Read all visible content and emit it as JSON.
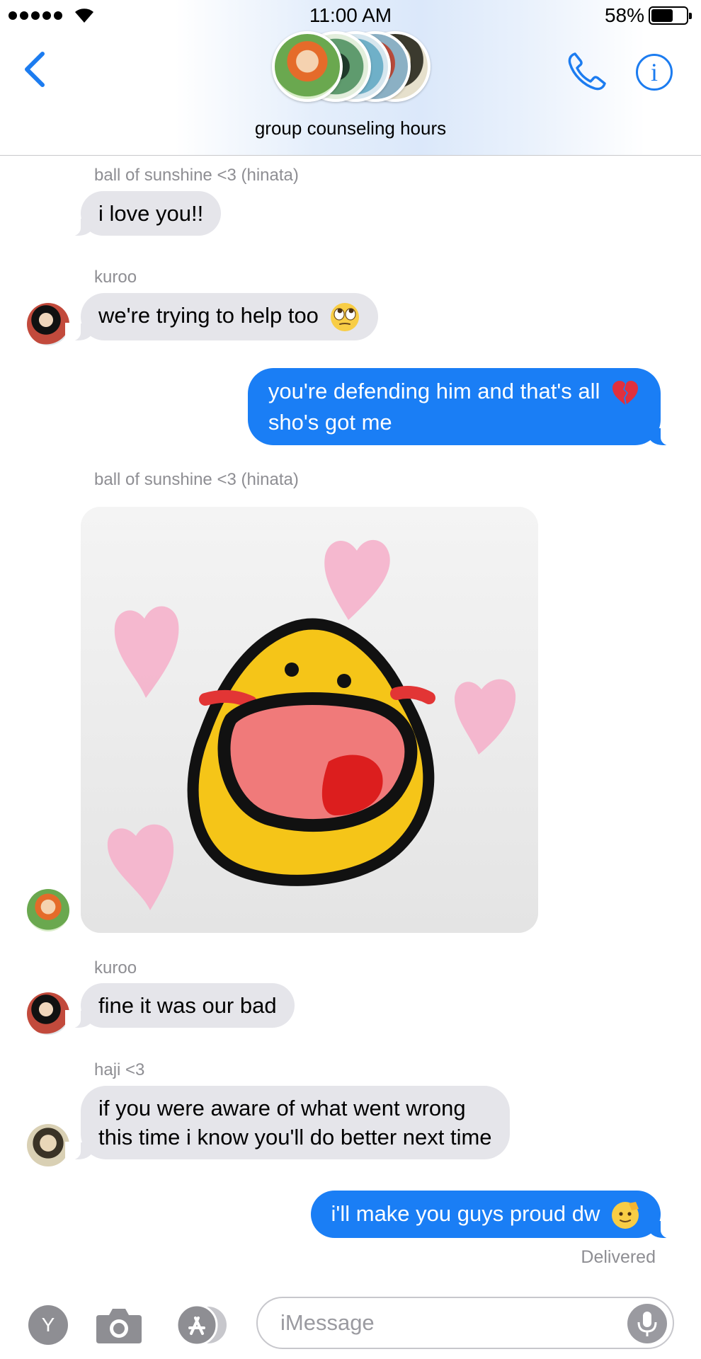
{
  "status_bar": {
    "time": "11:00 AM",
    "battery_percent": "58%",
    "battery_level": 0.58
  },
  "header": {
    "title": "group counseling hours"
  },
  "messages": [
    {
      "sender": "ball of sunshine <3 (hinata)",
      "text": "i love you!!"
    },
    {
      "sender": "kuroo",
      "text": "we're trying to help too",
      "emoji": "face-with-rolling-eyes"
    },
    {
      "outgoing": true,
      "line1": "you're defending him and that's all",
      "line2": "sho's got me",
      "emoji": "broken-heart"
    },
    {
      "sender": "ball of sunshine <3 (hinata)",
      "image": "happy-yellow-blob-with-pink-hearts"
    },
    {
      "sender": "kuroo",
      "text": "fine it was our bad"
    },
    {
      "sender": "haji <3",
      "line1": "if you were aware of what went wrong",
      "line2": "this time i know you'll do better next time"
    },
    {
      "outgoing": true,
      "text": "i'll make you guys proud dw",
      "emoji": "saluting-face"
    }
  ],
  "delivered_label": "Delivered",
  "input": {
    "placeholder": "iMessage"
  },
  "apps_bar": {
    "y_button_label": "Y"
  },
  "colors": {
    "accent": "#1c7cf0",
    "outgoing_bubble": "#1a7ef5",
    "incoming_bubble": "#e5e5ea",
    "meta_text": "#8e8e93"
  }
}
